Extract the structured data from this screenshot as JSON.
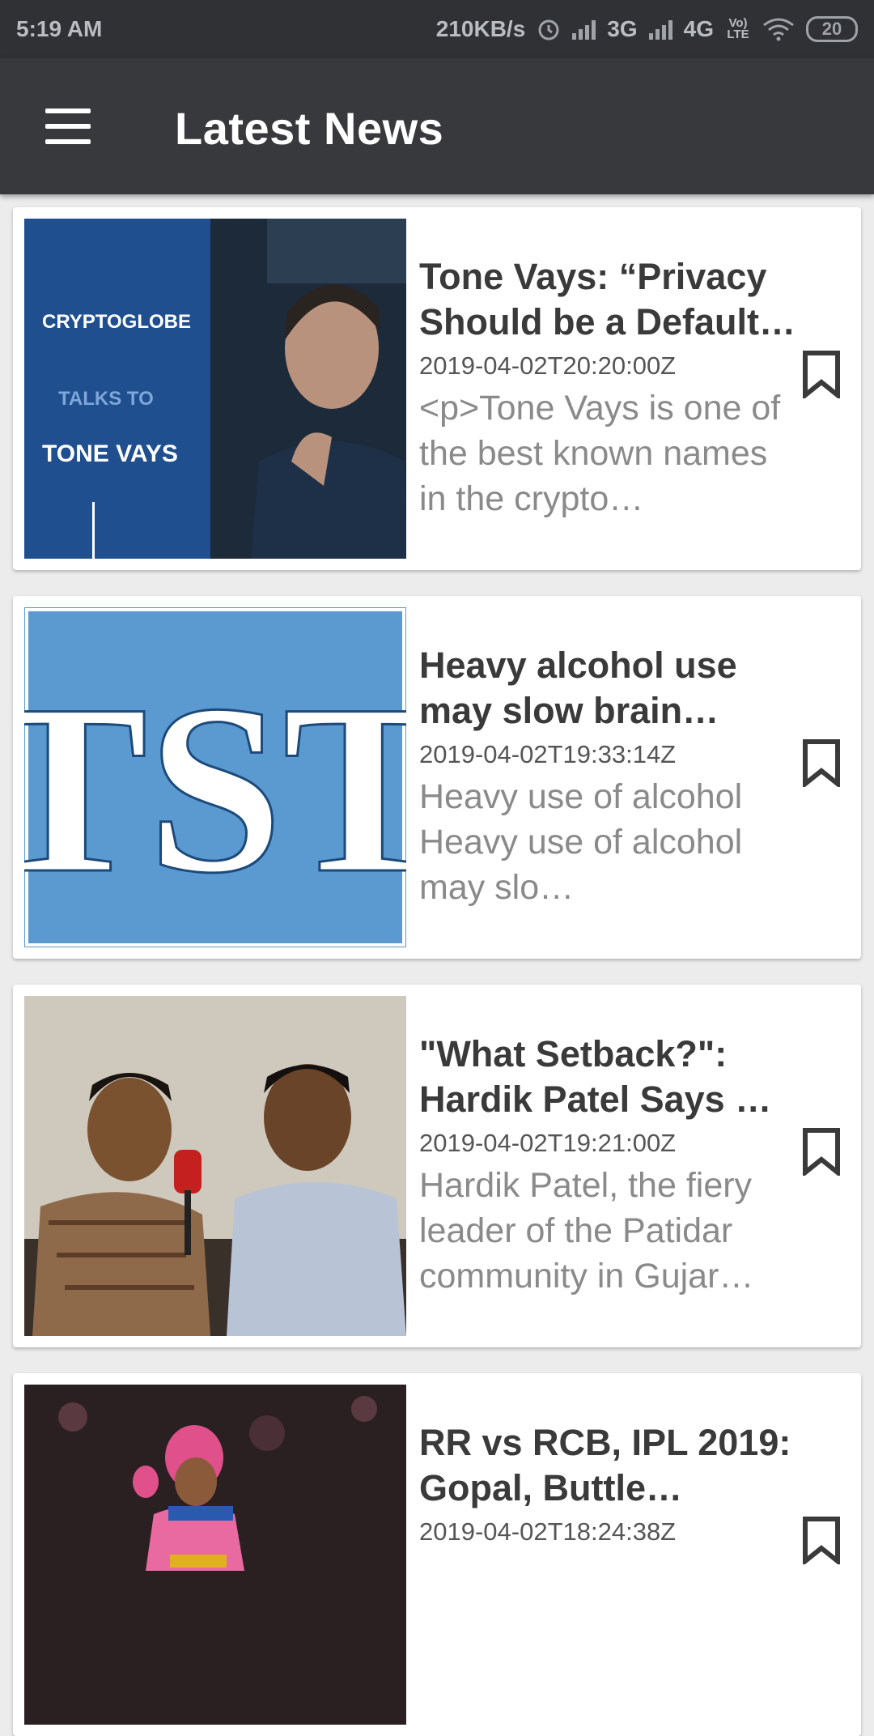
{
  "status_bar": {
    "time": "5:19 AM",
    "speed": "210KB/s",
    "net1": "3G",
    "net2": "4G",
    "volte": "Vo) LTE",
    "battery": "20"
  },
  "app_bar": {
    "title": "Latest News",
    "menu_icon": "hamburger-menu-icon"
  },
  "articles": [
    {
      "title": "Tone Vays: “Privacy Should be a Default…",
      "date": "2019-04-02T20:20:00Z",
      "description": "<p>Tone Vays is one of the best known names in the crypto…",
      "thumb_text": [
        "CRYPTOGLOBE",
        "TALKS TO",
        "TONE VAYS"
      ],
      "bookmark_icon": "bookmark-icon"
    },
    {
      "title": "Heavy alcohol use may slow brain…",
      "date": "2019-04-02T19:33:14Z",
      "description": "Heavy use of alcohol Heavy use of alcohol  may slo…",
      "thumb_text": [
        "TST"
      ],
      "bookmark_icon": "bookmark-icon"
    },
    {
      "title": "\"What Setback?\": Hardik Patel Says …",
      "date": "2019-04-02T19:21:00Z",
      "description": "Hardik Patel, the fiery leader of the Patidar community in Gujar…",
      "thumb_text": [],
      "bookmark_icon": "bookmark-icon"
    },
    {
      "title": "RR vs RCB, IPL 2019: Gopal, Buttle…",
      "date": "2019-04-02T18:24:38Z",
      "description": "",
      "thumb_text": [],
      "bookmark_icon": "bookmark-icon"
    }
  ]
}
